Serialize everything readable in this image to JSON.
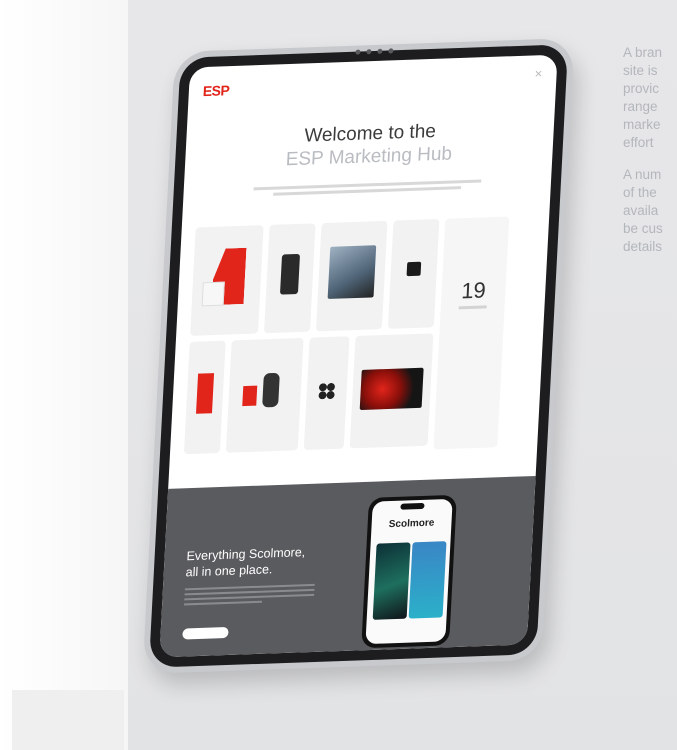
{
  "side_text": {
    "paragraph1": [
      "A bran",
      "site is",
      "provic",
      "range",
      "marke",
      "effort"
    ],
    "paragraph2": [
      "A num",
      "of the",
      "availa",
      "be cus",
      "details"
    ]
  },
  "hub": {
    "logo": "ESP",
    "title_line1": "Welcome to the",
    "title_line2": "ESP Marketing Hub",
    "stat_value": "19"
  },
  "footer": {
    "title_line1": "Everything Scolmore,",
    "title_line2": "all in one place."
  },
  "phone": {
    "brand": "Scolmore"
  },
  "colors": {
    "brand_red": "#e1251b",
    "footer_grey": "#5a5b5e",
    "background": "#e4e5e7"
  }
}
